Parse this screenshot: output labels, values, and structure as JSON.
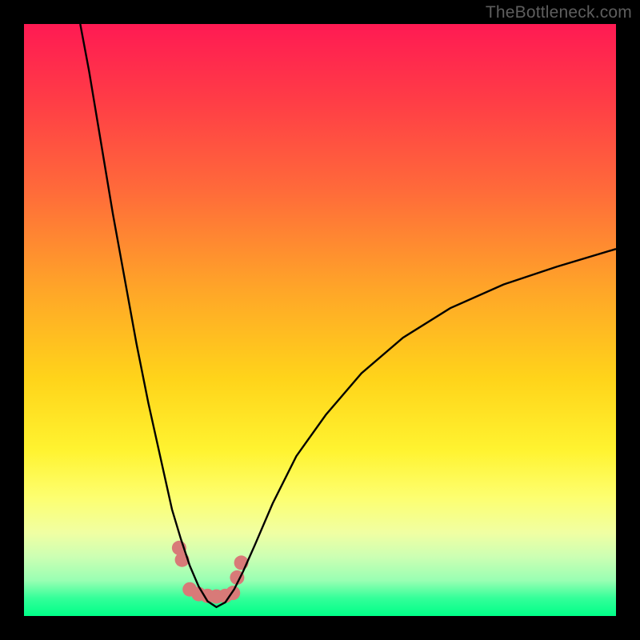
{
  "watermark": "TheBottleneck.com",
  "colors": {
    "frame": "#000000",
    "curve": "#000000",
    "dots": "#d87a78",
    "gradient_top": "#ff1a53",
    "gradient_bottom": "#00ff88"
  },
  "chart_data": {
    "type": "line",
    "title": "",
    "xlabel": "",
    "ylabel": "",
    "xlim": [
      0,
      100
    ],
    "ylim": [
      0,
      100
    ],
    "grid": false,
    "legend": false,
    "description": "Bottleneck-style V-curve (percent mismatch vs. component balance). Minimum at x≈32 where y≈0; both branches rise steeply away from the minimum; left branch starts near (9,100), right branch exits near (100,62).",
    "series": [
      {
        "name": "curve",
        "x": [
          9.5,
          11,
          13,
          15,
          17,
          19,
          21,
          23,
          25,
          26.5,
          28,
          29.5,
          31,
          32.5,
          34,
          35.5,
          37,
          39,
          42,
          46,
          51,
          57,
          64,
          72,
          81,
          90,
          100
        ],
        "y": [
          100,
          92,
          80,
          68,
          57,
          46,
          36,
          27,
          18,
          13,
          8.5,
          5,
          2.5,
          1.5,
          2.3,
          4.5,
          7.5,
          12,
          19,
          27,
          34,
          41,
          47,
          52,
          56,
          59,
          62
        ]
      }
    ],
    "dots": {
      "x": [
        26.2,
        26.7,
        28.0,
        29.5,
        31.0,
        32.5,
        34.0,
        35.3,
        36.0,
        36.7
      ],
      "y": [
        11.5,
        9.5,
        4.5,
        3.7,
        3.4,
        3.3,
        3.4,
        3.9,
        6.5,
        9.0
      ]
    }
  }
}
